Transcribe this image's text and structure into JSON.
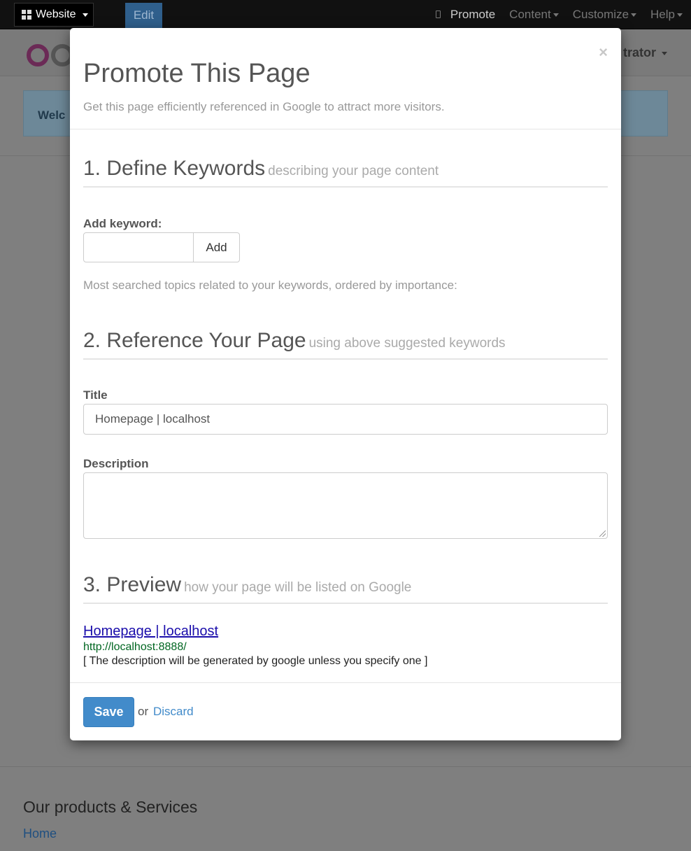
{
  "topbar": {
    "website_label": "Website",
    "edit_label": "Edit",
    "promote_label": "Promote",
    "content_label": "Content",
    "customize_label": "Customize",
    "help_label": "Help"
  },
  "background": {
    "user_label": "trator",
    "alert_text": "Welc",
    "footer_title": "Our products & Services",
    "footer_link": "Home"
  },
  "modal": {
    "close_symbol": "×",
    "title": "Promote This Page",
    "subtitle": "Get this page efficiently referenced in Google to attract more visitors.",
    "section1": {
      "heading": "1. Define Keywords",
      "subheading": "describing your page content"
    },
    "keyword_label": "Add keyword:",
    "keyword_value": "",
    "add_button": "Add",
    "help_text": "Most searched topics related to your keywords, ordered by importance:",
    "section2": {
      "heading": "2. Reference Your Page",
      "subheading": "using above suggested keywords"
    },
    "title_label": "Title",
    "title_value": "Homepage | localhost",
    "description_label": "Description",
    "description_value": "",
    "section3": {
      "heading": "3. Preview",
      "subheading": "how your page will be listed on Google"
    },
    "preview": {
      "title": "Homepage | localhost",
      "url": "http://localhost:8888/",
      "description": "[ The description will be generated by google unless you specify one ]"
    },
    "save_button": "Save",
    "or_text": "or",
    "discard_link": "Discard"
  },
  "colors": {
    "accent": "#428bca",
    "preview_title": "#1a0dab",
    "preview_url": "#006621"
  }
}
